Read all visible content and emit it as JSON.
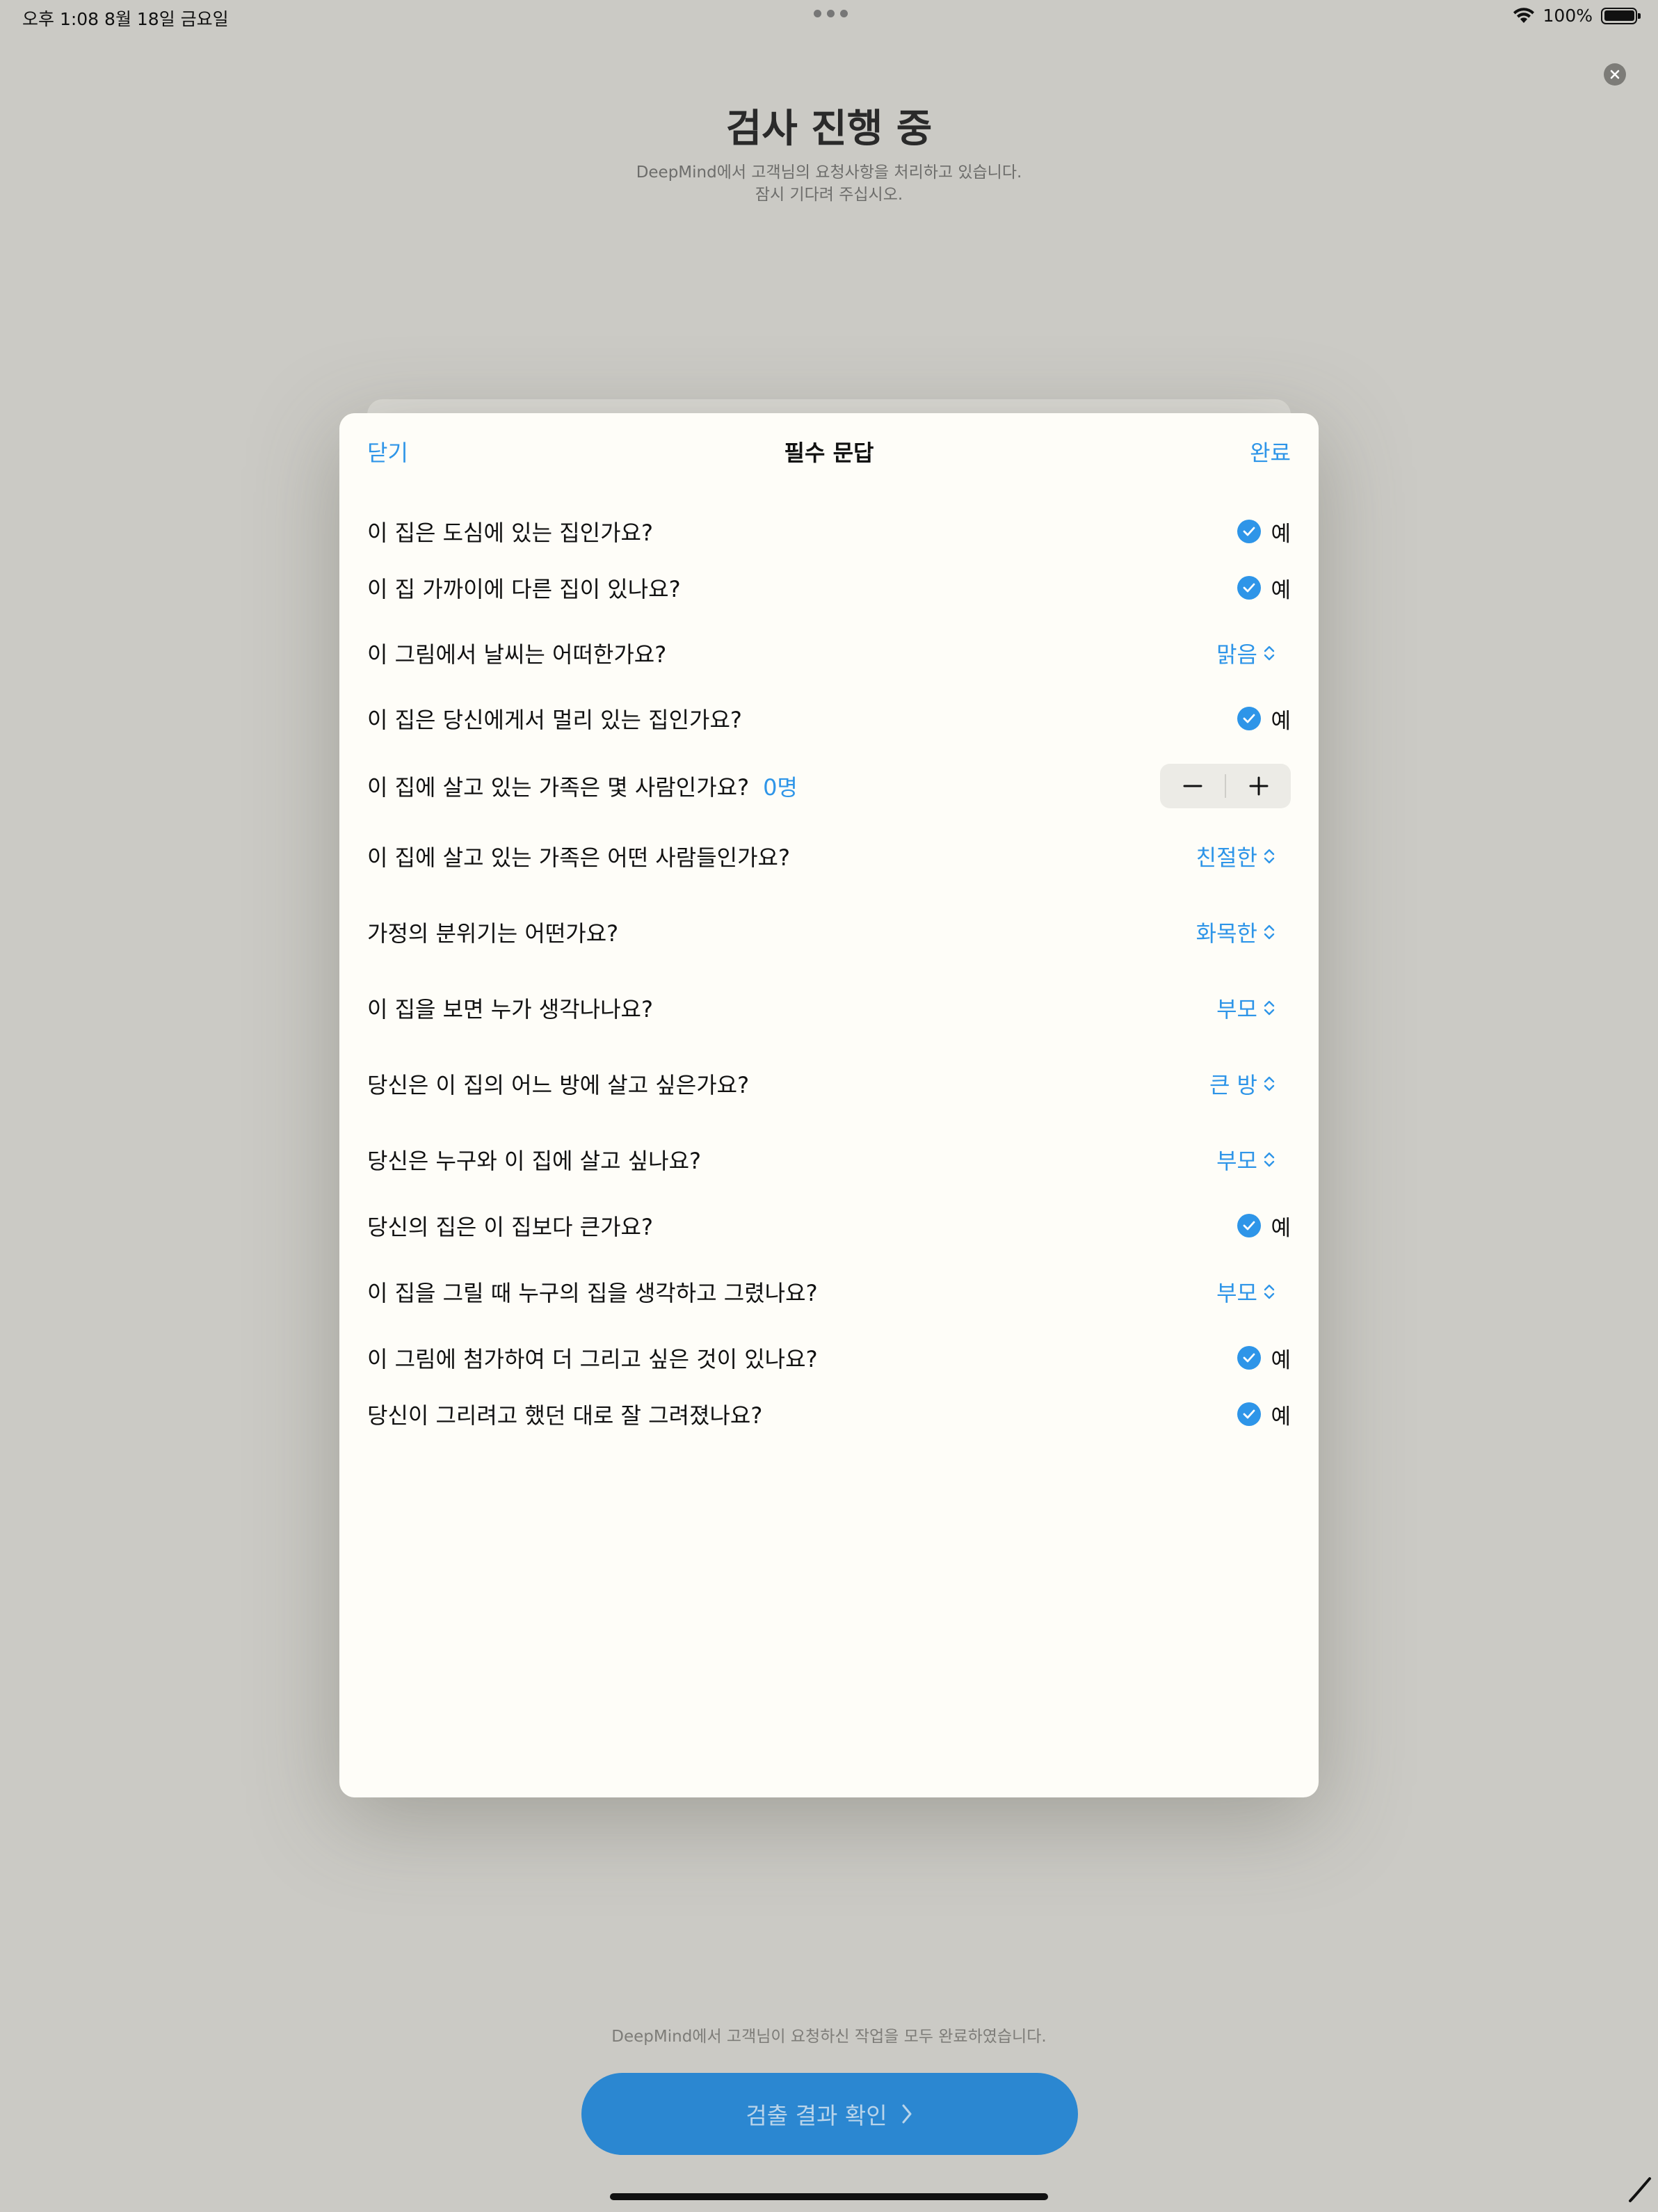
{
  "status_bar": {
    "time_date": "오후 1:08   8월 18일 금요일",
    "battery": "100%"
  },
  "background": {
    "title": "검사 진행 중",
    "subtitle_line1": "DeepMind에서 고객님의 요청사항을 처리하고 있습니다.",
    "subtitle_line2": "잠시 기다려 주십시오.",
    "footer_message": "DeepMind에서 고객님이 요청하신 작업을 모두 완료하였습니다.",
    "result_button": "검출 결과 확인"
  },
  "sheet": {
    "close_label": "닫기",
    "title": "필수 문답",
    "done_label": "완료",
    "questions": [
      {
        "text": "이 집은 도심에 있는 집인가요?",
        "answer": "예"
      },
      {
        "text": "이 집 가까이에 다른 집이 있나요?",
        "answer": "예"
      },
      {
        "text": "이 그림에서 날씨는 어떠한가요?",
        "answer": "맑음"
      },
      {
        "text": "이 집은 당신에게서 멀리 있는 집인가요?",
        "answer": "예"
      },
      {
        "text": "이 집에 살고 있는 가족은 몇 사람인가요?",
        "count": "0명"
      },
      {
        "text": "이 집에 살고 있는 가족은 어떤 사람들인가요?",
        "answer": "친절한"
      },
      {
        "text": "가정의 분위기는 어떤가요?",
        "answer": "화목한"
      },
      {
        "text": "이 집을 보면 누가 생각나나요?",
        "answer": "부모"
      },
      {
        "text": "당신은 이 집의 어느 방에 살고 싶은가요?",
        "answer": "큰 방"
      },
      {
        "text": "당신은 누구와 이 집에 살고 싶나요?",
        "answer": "부모"
      },
      {
        "text": "당신의 집은 이 집보다 큰가요?",
        "answer": "예"
      },
      {
        "text": "이 집을 그릴 때 누구의 집을 생각하고 그렸나요?",
        "answer": "부모"
      },
      {
        "text": "이 그림에 첨가하여 더 그리고 싶은 것이 있나요?",
        "answer": "예"
      },
      {
        "text": "당신이 그리려고 했던 대로 잘 그려졌나요?",
        "answer": "예"
      }
    ]
  },
  "colors": {
    "accent": "#2e95e8",
    "background": "#cbcac5",
    "sheet": "#fefdf8",
    "button": "#2b87d1"
  }
}
